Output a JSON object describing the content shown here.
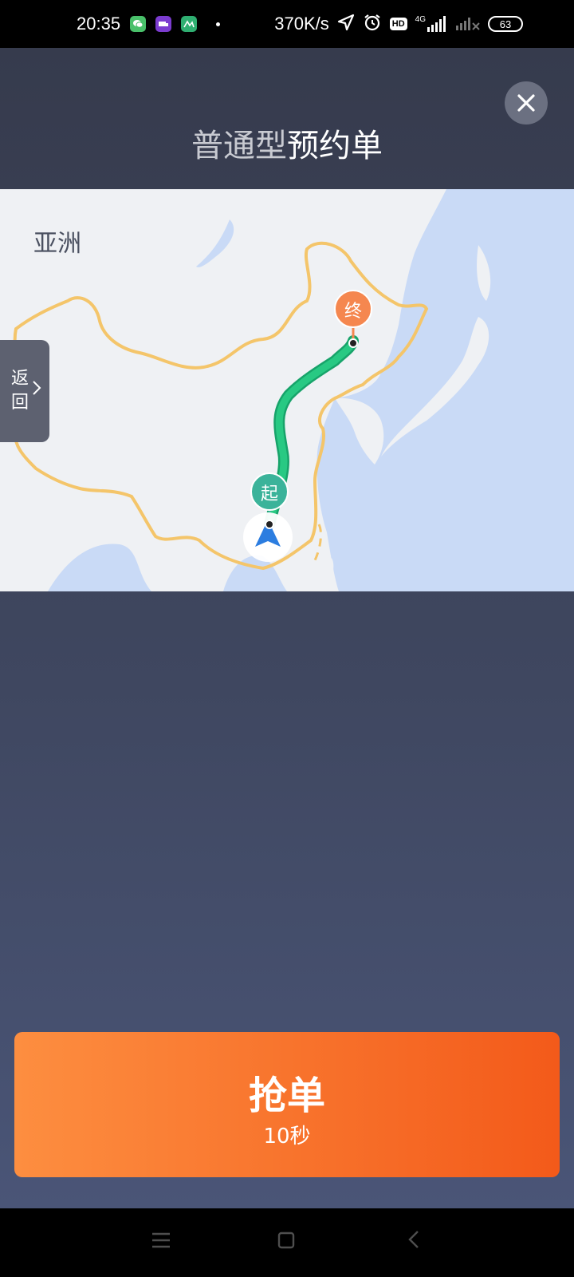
{
  "status_bar": {
    "time": "20:35",
    "net_speed": "370K/s",
    "network_type": "4G",
    "hd_badge": "HD",
    "battery": "63",
    "icons": [
      "wechat-icon",
      "app-icon",
      "app-icon",
      "location-arrow-icon",
      "alarm-icon",
      "signal-icon",
      "signal-icon"
    ]
  },
  "header": {
    "title_prefix": "普通型",
    "title_main": "预约单",
    "close_icon": "close-icon"
  },
  "map": {
    "region_label": "亚洲",
    "start_marker": "起",
    "end_marker": "终",
    "route_color": "#1fbf7b",
    "start_color": "#3bb39a",
    "end_color": "#f5874f",
    "border_color": "#f4c56a"
  },
  "back_tab": {
    "label": "返回",
    "icon": "chevron-right-icon"
  },
  "action": {
    "label": "抢单",
    "countdown": "10秒"
  },
  "nav_bar": {
    "icons": [
      "menu-icon",
      "home-square-icon",
      "back-chevron-icon"
    ]
  }
}
